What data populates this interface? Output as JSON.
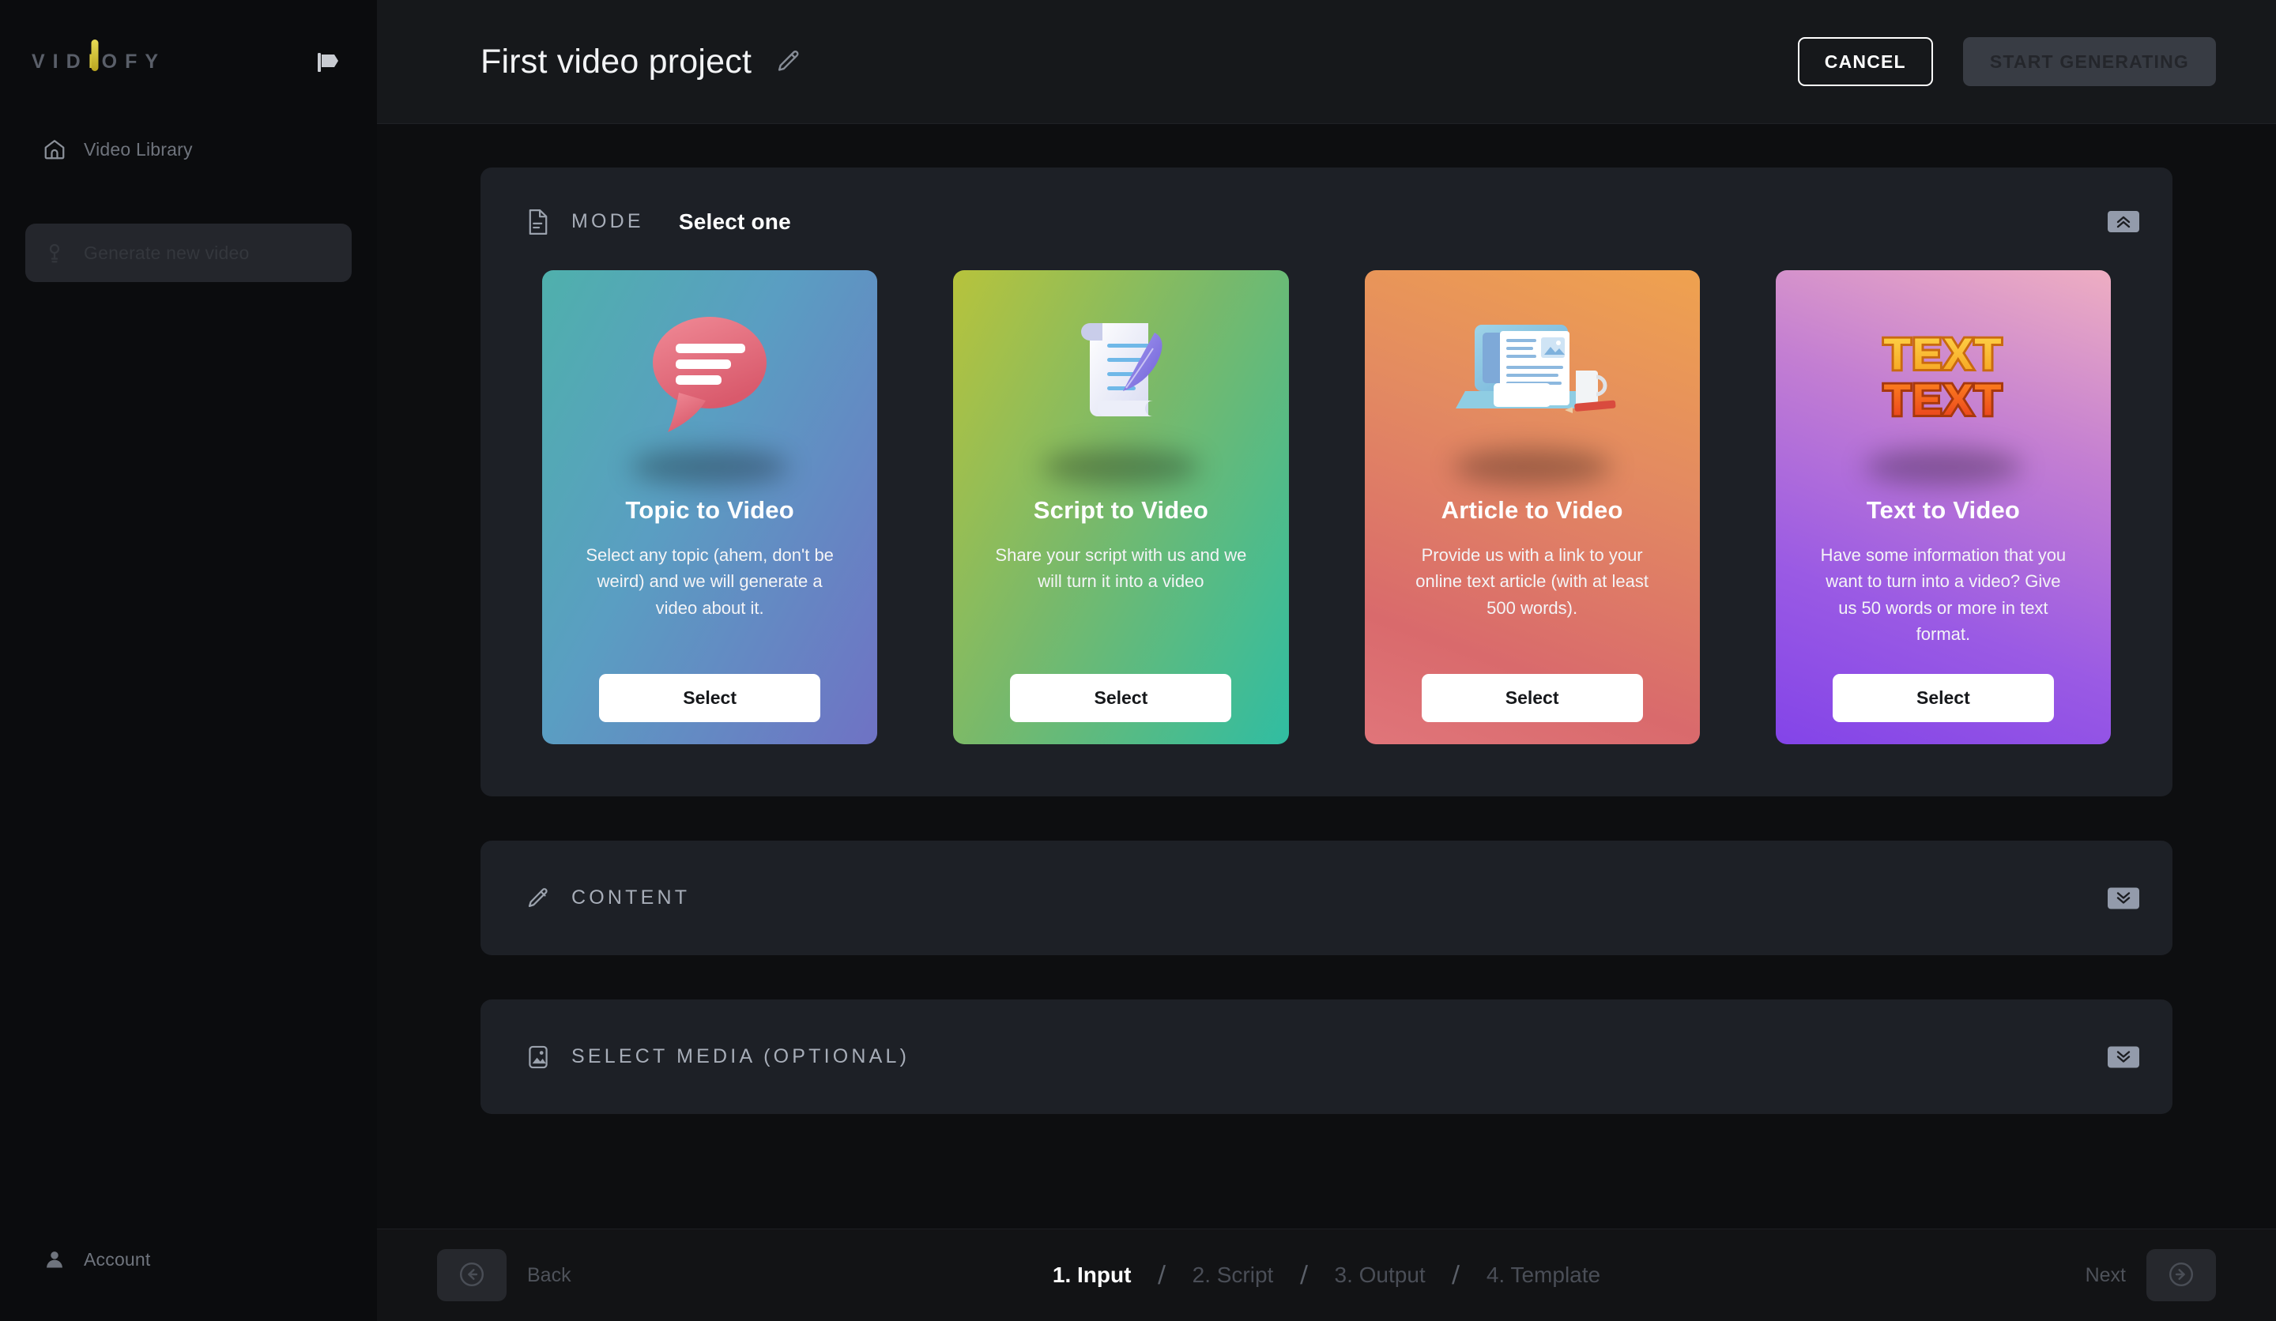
{
  "brand": {
    "name": "VIDIOFY",
    "letters_before_i": "VID",
    "accent_letter": "I",
    "letters_after_i": "OFY",
    "accent_color": "#d8c83c"
  },
  "sidebar": {
    "flag_icon": "flag-icon",
    "items": [
      {
        "label": "Video Library",
        "icon": "home-icon"
      },
      {
        "label": "Generate new video",
        "icon": "magic-wand-icon"
      }
    ],
    "account": {
      "label": "Account",
      "icon": "user-icon"
    }
  },
  "header": {
    "project_title": "First video project",
    "edit_icon": "pencil-icon",
    "cancel_label": "CANCEL",
    "start_generating_label": "START GENERATING"
  },
  "sections": {
    "mode": {
      "icon": "document-icon",
      "label": "MODE",
      "value": "Select one",
      "collapse_icon": "double-chevron-up-icon"
    },
    "content": {
      "icon": "pencil-icon",
      "label": "CONTENT",
      "collapse_icon": "double-chevron-down-icon"
    },
    "media": {
      "icon": "image-icon",
      "label": "SELECT MEDIA (OPTIONAL)",
      "collapse_icon": "double-chevron-down-icon"
    }
  },
  "mode_cards": [
    {
      "title": "Topic to Video",
      "description": "Select any topic (ahem, don't be weird) and we will generate a video about it.",
      "button_label": "Select",
      "art": "speech-bubble-icon",
      "gradient": "#4fb0ac → #6f72c4"
    },
    {
      "title": "Script to Video",
      "description": "Share your script with us and we will turn it into a video",
      "button_label": "Select",
      "art": "scroll-quill-icon",
      "gradient": "#b7c33c → #30bda2"
    },
    {
      "title": "Article to Video",
      "description": "Provide us with a link to your online text article (with at least 500 words).",
      "button_label": "Select",
      "art": "laptop-article-icon",
      "gradient": "#efa24f → #d96a6c"
    },
    {
      "title": "Text to Video",
      "description": "Have some information that you want to turn into a video? Give us 50 words or more in text format.",
      "button_label": "Select",
      "art": "text-text-icon",
      "gradient": "#eeaec2 → #8344e8"
    }
  ],
  "footer": {
    "back_label": "Back",
    "back_icon": "arrow-left-circle-icon",
    "next_label": "Next",
    "next_icon": "arrow-right-circle-icon",
    "separator": "/",
    "steps": [
      {
        "label": "1. Input",
        "active": true
      },
      {
        "label": "2. Script",
        "active": false
      },
      {
        "label": "3. Output",
        "active": false
      },
      {
        "label": "4. Template",
        "active": false
      }
    ]
  }
}
